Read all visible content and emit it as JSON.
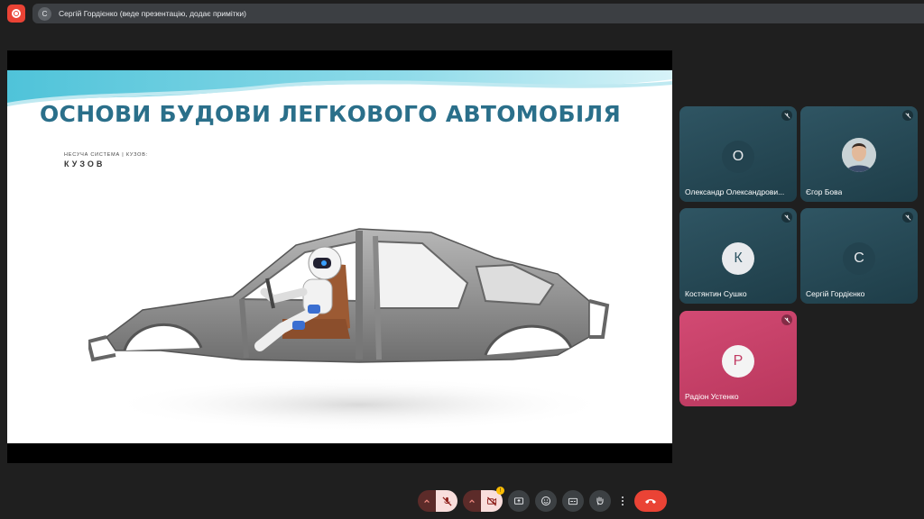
{
  "presenter_bar": {
    "avatar_letter": "С",
    "text": "Сергій Гордієнко (веде презентацію, додає примітки)"
  },
  "slide": {
    "title": "ОСНОВИ БУДОВИ ЛЕГКОВОГО АВТОМОБІЛЯ",
    "caption": "НЕСУЧА СИСТЕМА | КУЗОВ:",
    "subtitle": "КУЗОВ"
  },
  "participants": [
    {
      "letter": "О",
      "name": "Олександр Олександрови...",
      "color": "teal",
      "muted": true
    },
    {
      "letter": "",
      "name": "Єгор Бова",
      "color": "teal",
      "muted": true,
      "has_photo": true
    },
    {
      "letter": "К",
      "name": "Костянтин Сушко",
      "color": "teal",
      "muted": true
    },
    {
      "letter": "С",
      "name": "Сергій Гордієнко",
      "color": "teal",
      "muted": true
    },
    {
      "letter": "Р",
      "name": "Радіон Устенко",
      "color": "pink",
      "muted": true
    }
  ],
  "controls": {
    "camera_badge": "!",
    "icons": [
      "chevron-up-icon",
      "mic-off-icon",
      "chevron-up-icon",
      "camera-off-icon",
      "present-icon",
      "emoji-icon",
      "captions-icon",
      "raise-hand-icon",
      "more-icon",
      "end-call-icon"
    ]
  },
  "colors": {
    "title": "#2a6f8a",
    "tile_teal": "#2f5563",
    "tile_pink": "#d24a73",
    "end_call": "#ea4335",
    "mic_off_bg": "#f9dedc"
  }
}
